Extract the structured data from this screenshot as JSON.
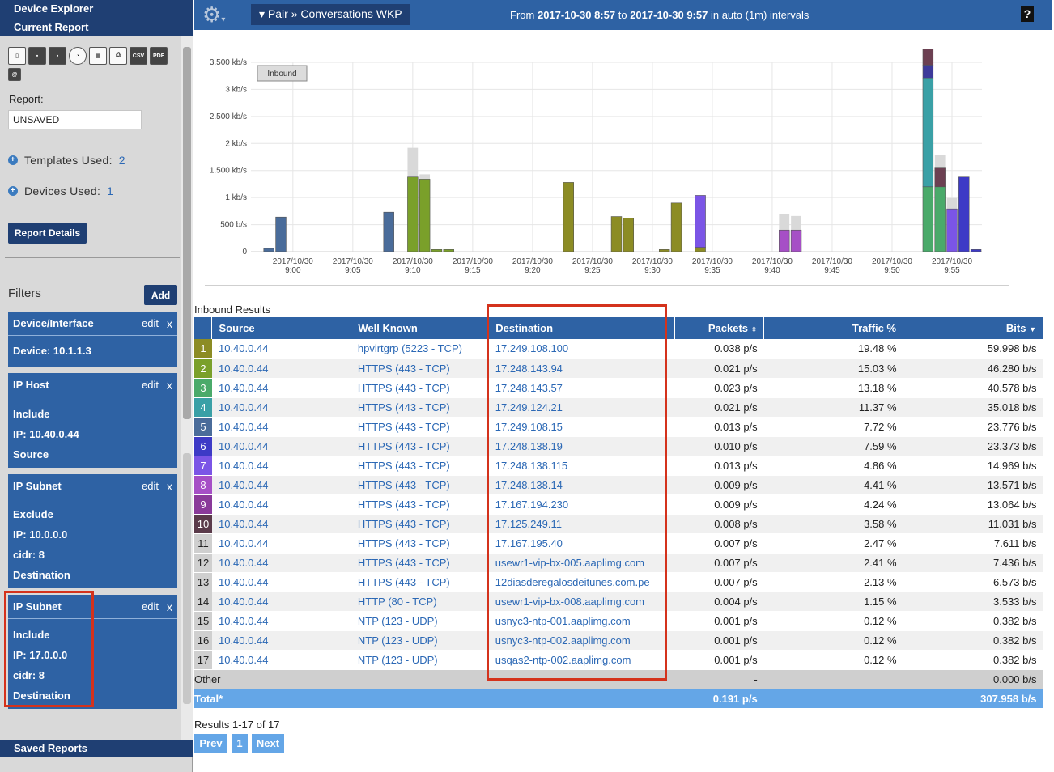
{
  "sidebar": {
    "title": "Device Explorer",
    "subtitle": "Current Report",
    "toolbar_icons": [
      "delete-icon",
      "save-icon",
      "save-as-icon",
      "schedule-icon",
      "layout-icon",
      "print-icon",
      "csv-icon",
      "pdf-icon",
      "email-icon"
    ],
    "toolbar_text": {
      "csv": "CSV",
      "pdf": "PDF",
      "email": "@"
    },
    "report_label": "Report:",
    "report_value": "UNSAVED",
    "templates_label": "Templates Used:",
    "templates_count": "2",
    "devices_label": "Devices Used:",
    "devices_count": "1",
    "report_details_button": "Report Details",
    "filters_label": "Filters",
    "add_button": "Add",
    "edit_label": "edit",
    "close_label": "x",
    "filters": [
      {
        "title": "Device/Interface",
        "lines": [
          "Device: 10.1.1.3"
        ]
      },
      {
        "title": "IP Host",
        "lines": [
          "Include",
          "IP: 10.40.0.44",
          "Source"
        ]
      },
      {
        "title": "IP Subnet",
        "lines": [
          "Exclude",
          "IP: 10.0.0.0",
          "cidr: 8",
          "Destination"
        ]
      },
      {
        "title": "IP Subnet",
        "lines": [
          "Include",
          "IP: 17.0.0.0",
          "cidr: 8",
          "Destination"
        ]
      }
    ],
    "saved_reports": "Saved Reports"
  },
  "topbar": {
    "breadcrumb": "▾ Pair » Conversations WKP",
    "range_from_label": "From",
    "range_from": "2017-10-30 8:57",
    "range_to_label": "to",
    "range_to": "2017-10-30 9:57",
    "range_suffix": "in auto (1m) intervals",
    "help": "?"
  },
  "chart_data": {
    "type": "bar",
    "legend_badge": "Inbound",
    "y_ticks": [
      "0",
      "500 b/s",
      "1 kb/s",
      "1.500 kb/s",
      "2 kb/s",
      "2.500 kb/s",
      "3 kb/s",
      "3.500 kb/s"
    ],
    "y_tick_values": [
      0,
      500,
      1000,
      1500,
      2000,
      2500,
      3000,
      3500
    ],
    "ylim": [
      0,
      3500
    ],
    "x_ticks": [
      "2017/10/30 9:00",
      "2017/10/30 9:05",
      "2017/10/30 9:10",
      "2017/10/30 9:15",
      "2017/10/30 9:20",
      "2017/10/30 9:25",
      "2017/10/30 9:30",
      "2017/10/30 9:35",
      "2017/10/30 9:40",
      "2017/10/30 9:45",
      "2017/10/30 9:50",
      "2017/10/30 9:55"
    ],
    "x_range_minutes": [
      57,
      117
    ],
    "bars": [
      {
        "minute": 58,
        "color": "#4a6c9a",
        "value": 60
      },
      {
        "minute": 59,
        "color": "#4a6c9a",
        "value": 640
      },
      {
        "minute": 68,
        "color": "#4a6c9a",
        "value": 730
      },
      {
        "minute": 70,
        "color": "#7aa02a",
        "value": 1380,
        "overlay": 1920
      },
      {
        "minute": 71,
        "color": "#7aa02a",
        "value": 1340,
        "overlay": 1430
      },
      {
        "minute": 72,
        "color": "#7aa02a",
        "value": 40
      },
      {
        "minute": 73,
        "color": "#7aa02a",
        "value": 40
      },
      {
        "minute": 83,
        "color": "#8c8c24",
        "value": 1280
      },
      {
        "minute": 87,
        "color": "#8c8c24",
        "value": 650
      },
      {
        "minute": 88,
        "color": "#8c8c24",
        "value": 620
      },
      {
        "minute": 91,
        "color": "#8c8c24",
        "value": 40
      },
      {
        "minute": 92,
        "color": "#8c8c24",
        "value": 900
      },
      {
        "minute": 94,
        "color": "#8c8c24",
        "value": 80
      },
      {
        "minute": 94,
        "color": "#7b55e6",
        "value": 960,
        "offset": 80
      },
      {
        "minute": 101,
        "color": "#a64fc6",
        "value": 400,
        "overlay": 690
      },
      {
        "minute": 102,
        "color": "#a64fc6",
        "value": 400,
        "overlay": 660
      },
      {
        "minute": 113,
        "color": "#4aaa6a",
        "value": 1200
      },
      {
        "minute": 113,
        "color": "#3aa0a6",
        "value": 2000,
        "offset": 1200
      },
      {
        "minute": 113,
        "color": "#3d3a9a",
        "value": 250,
        "offset": 3200
      },
      {
        "minute": 113,
        "color": "#6c4052",
        "value": 330,
        "offset": 3450
      },
      {
        "minute": 114,
        "color": "#4aaa6a",
        "value": 1200
      },
      {
        "minute": 114,
        "color": "#6c4052",
        "value": 360,
        "offset": 1200,
        "overlay": 1780
      },
      {
        "minute": 115,
        "color": "#7b55e6",
        "value": 790,
        "overlay": 990
      },
      {
        "minute": 116,
        "color": "#3d3ac6",
        "value": 1380
      },
      {
        "minute": 117,
        "color": "#3d3ac6",
        "value": 40
      }
    ]
  },
  "results": {
    "title": "Inbound Results",
    "columns": {
      "source": "Source",
      "well_known": "Well Known",
      "destination": "Destination",
      "packets": "Packets",
      "traffic": "Traffic %",
      "bits": "Bits"
    },
    "rows": [
      {
        "n": "1",
        "color": "#8c8c24",
        "source": "10.40.0.44",
        "wk": "hpvirtgrp (5223 - TCP)",
        "dest": "17.249.108.100",
        "packets": "0.038 p/s",
        "traffic": "19.48 %",
        "bits": "59.998 b/s"
      },
      {
        "n": "2",
        "color": "#7aa02a",
        "source": "10.40.0.44",
        "wk": "HTTPS (443 - TCP)",
        "dest": "17.248.143.94",
        "packets": "0.021 p/s",
        "traffic": "15.03 %",
        "bits": "46.280 b/s"
      },
      {
        "n": "3",
        "color": "#4aaa6a",
        "source": "10.40.0.44",
        "wk": "HTTPS (443 - TCP)",
        "dest": "17.248.143.57",
        "packets": "0.023 p/s",
        "traffic": "13.18 %",
        "bits": "40.578 b/s"
      },
      {
        "n": "4",
        "color": "#3aa0a6",
        "source": "10.40.0.44",
        "wk": "HTTPS (443 - TCP)",
        "dest": "17.249.124.21",
        "packets": "0.021 p/s",
        "traffic": "11.37 %",
        "bits": "35.018 b/s"
      },
      {
        "n": "5",
        "color": "#4a6c9a",
        "source": "10.40.0.44",
        "wk": "HTTPS (443 - TCP)",
        "dest": "17.249.108.15",
        "packets": "0.013 p/s",
        "traffic": "7.72 %",
        "bits": "23.776 b/s"
      },
      {
        "n": "6",
        "color": "#3d3ac6",
        "source": "10.40.0.44",
        "wk": "HTTPS (443 - TCP)",
        "dest": "17.248.138.19",
        "packets": "0.010 p/s",
        "traffic": "7.59 %",
        "bits": "23.373 b/s"
      },
      {
        "n": "7",
        "color": "#7b55e6",
        "source": "10.40.0.44",
        "wk": "HTTPS (443 - TCP)",
        "dest": "17.248.138.115",
        "packets": "0.013 p/s",
        "traffic": "4.86 %",
        "bits": "14.969 b/s"
      },
      {
        "n": "8",
        "color": "#a64fc6",
        "source": "10.40.0.44",
        "wk": "HTTPS (443 - TCP)",
        "dest": "17.248.138.14",
        "packets": "0.009 p/s",
        "traffic": "4.41 %",
        "bits": "13.571 b/s"
      },
      {
        "n": "9",
        "color": "#8a3a9a",
        "source": "10.40.0.44",
        "wk": "HTTPS (443 - TCP)",
        "dest": "17.167.194.230",
        "packets": "0.009 p/s",
        "traffic": "4.24 %",
        "bits": "13.064 b/s"
      },
      {
        "n": "10",
        "color": "#5a3a4a",
        "source": "10.40.0.44",
        "wk": "HTTPS (443 - TCP)",
        "dest": "17.125.249.11",
        "packets": "0.008 p/s",
        "traffic": "3.58 %",
        "bits": "11.031 b/s"
      },
      {
        "n": "11",
        "color": "",
        "source": "10.40.0.44",
        "wk": "HTTPS (443 - TCP)",
        "dest": "17.167.195.40",
        "packets": "0.007 p/s",
        "traffic": "2.47 %",
        "bits": "7.611 b/s"
      },
      {
        "n": "12",
        "color": "",
        "source": "10.40.0.44",
        "wk": "HTTPS (443 - TCP)",
        "dest": "usewr1-vip-bx-005.aaplimg.com",
        "packets": "0.007 p/s",
        "traffic": "2.41 %",
        "bits": "7.436 b/s"
      },
      {
        "n": "13",
        "color": "",
        "source": "10.40.0.44",
        "wk": "HTTPS (443 - TCP)",
        "dest": "12diasderegalosdeitunes.com.pe",
        "packets": "0.007 p/s",
        "traffic": "2.13 %",
        "bits": "6.573 b/s"
      },
      {
        "n": "14",
        "color": "",
        "source": "10.40.0.44",
        "wk": "HTTP (80 - TCP)",
        "dest": "usewr1-vip-bx-008.aaplimg.com",
        "packets": "0.004 p/s",
        "traffic": "1.15 %",
        "bits": "3.533 b/s"
      },
      {
        "n": "15",
        "color": "",
        "source": "10.40.0.44",
        "wk": "NTP (123 - UDP)",
        "dest": "usnyc3-ntp-001.aaplimg.com",
        "packets": "0.001 p/s",
        "traffic": "0.12 %",
        "bits": "0.382 b/s"
      },
      {
        "n": "16",
        "color": "",
        "source": "10.40.0.44",
        "wk": "NTP (123 - UDP)",
        "dest": "usnyc3-ntp-002.aaplimg.com",
        "packets": "0.001 p/s",
        "traffic": "0.12 %",
        "bits": "0.382 b/s"
      },
      {
        "n": "17",
        "color": "",
        "source": "10.40.0.44",
        "wk": "NTP (123 - UDP)",
        "dest": "usqas2-ntp-002.aaplimg.com",
        "packets": "0.001 p/s",
        "traffic": "0.12 %",
        "bits": "0.382 b/s"
      }
    ],
    "other": {
      "label": "Other",
      "packets": "-",
      "bits": "0.000 b/s"
    },
    "total": {
      "label": "Total*",
      "packets": "0.191 p/s",
      "bits": "307.958 b/s"
    }
  },
  "pager": {
    "summary": "Results 1-17 of 17",
    "prev": "Prev",
    "page": "1",
    "next": "Next"
  },
  "highlight_color": "#d4321c"
}
